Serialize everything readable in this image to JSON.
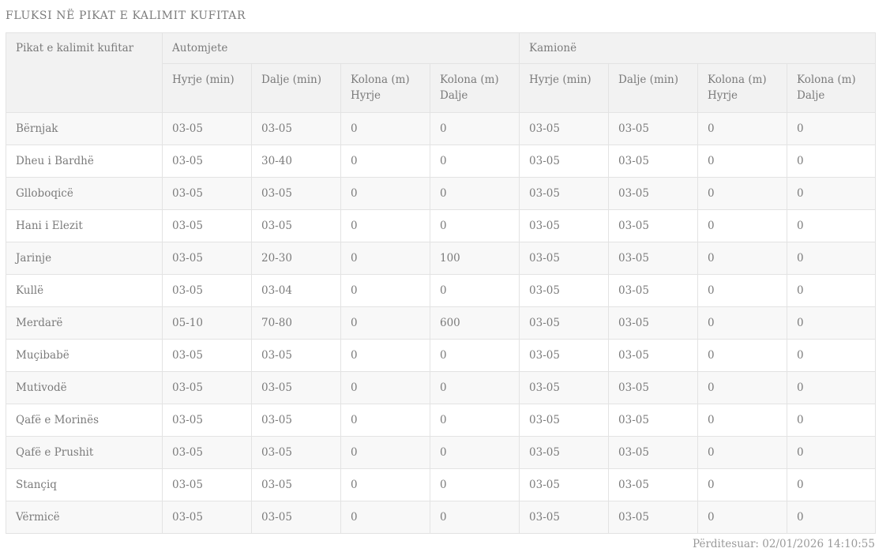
{
  "page": {
    "title": "FLUKSI NË PIKAT E KALIMIT KUFITAR",
    "updated_text": "Përditesuar: 02/01/2026 14:10:55"
  },
  "colors": {
    "text_gray": "#7b7b7b",
    "header_bg": "#f2f2f2",
    "stripe_bg": "#f8f8f8",
    "border": "#e3e3e3",
    "footer_text": "#9a9a9a"
  },
  "table": {
    "col1_header": "Pikat e kalimit kufitar",
    "groups": [
      {
        "label": "Automjete"
      },
      {
        "label": "Kamionë"
      }
    ],
    "sub_headers": [
      "Hyrje (min)",
      "Dalje (min)",
      "Kolona (m) Hyrje",
      "Kolona (m) Dalje",
      "Hyrje (min)",
      "Dalje (min)",
      "Kolona (m) Hyrje",
      "Kolona (m) Dalje"
    ],
    "rows": [
      {
        "name": "Bërnjak",
        "values": [
          "03-05",
          "03-05",
          "0",
          "0",
          "03-05",
          "03-05",
          "0",
          "0"
        ]
      },
      {
        "name": "Dheu i Bardhë",
        "values": [
          "03-05",
          "30-40",
          "0",
          "0",
          "03-05",
          "03-05",
          "0",
          "0"
        ]
      },
      {
        "name": "Glloboqicë",
        "values": [
          "03-05",
          "03-05",
          "0",
          "0",
          "03-05",
          "03-05",
          "0",
          "0"
        ]
      },
      {
        "name": "Hani i Elezit",
        "values": [
          "03-05",
          "03-05",
          "0",
          "0",
          "03-05",
          "03-05",
          "0",
          "0"
        ]
      },
      {
        "name": "Jarinje",
        "values": [
          "03-05",
          "20-30",
          "0",
          "100",
          "03-05",
          "03-05",
          "0",
          "0"
        ]
      },
      {
        "name": "Kullë",
        "values": [
          "03-05",
          "03-04",
          "0",
          "0",
          "03-05",
          "03-05",
          "0",
          "0"
        ]
      },
      {
        "name": "Merdarë",
        "values": [
          "05-10",
          "70-80",
          "0",
          "600",
          "03-05",
          "03-05",
          "0",
          "0"
        ]
      },
      {
        "name": "Muçibabë",
        "values": [
          "03-05",
          "03-05",
          "0",
          "0",
          "03-05",
          "03-05",
          "0",
          "0"
        ]
      },
      {
        "name": "Mutivodë",
        "values": [
          "03-05",
          "03-05",
          "0",
          "0",
          "03-05",
          "03-05",
          "0",
          "0"
        ]
      },
      {
        "name": "Qafë e Morinës",
        "values": [
          "03-05",
          "03-05",
          "0",
          "0",
          "03-05",
          "03-05",
          "0",
          "0"
        ]
      },
      {
        "name": "Qafë e Prushit",
        "values": [
          "03-05",
          "03-05",
          "0",
          "0",
          "03-05",
          "03-05",
          "0",
          "0"
        ]
      },
      {
        "name": "Stançiq",
        "values": [
          "03-05",
          "03-05",
          "0",
          "0",
          "03-05",
          "03-05",
          "0",
          "0"
        ]
      },
      {
        "name": "Vërmicë",
        "values": [
          "03-05",
          "03-05",
          "0",
          "0",
          "03-05",
          "03-05",
          "0",
          "0"
        ]
      }
    ]
  }
}
